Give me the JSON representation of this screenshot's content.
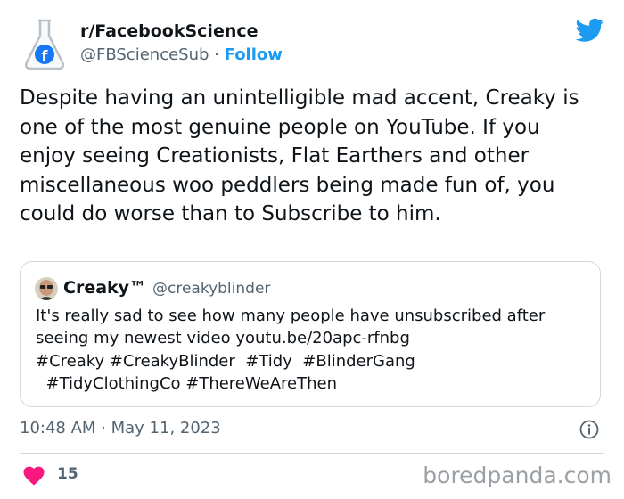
{
  "header": {
    "display_name": "r/FacebookScience",
    "handle": "@FBScienceSub",
    "separator": "·",
    "follow_label": "Follow"
  },
  "tweet": {
    "text": "Despite having an unintelligible mad accent, Creaky is one of the most genuine people on YouTube. If you enjoy seeing Creationists, Flat Earthers and other miscellaneous woo peddlers being made fun of, you could do worse than to Subscribe to him."
  },
  "quote": {
    "name": "Creaky™",
    "handle": "@creakyblinder",
    "text": "It's really sad to see how many people have unsubscribed after\nseeing my newest video youtu.be/20apc-rfnbg\n#Creaky #CreakyBlinder  #Tidy  #BlinderGang\n  #TidyClothingCo #ThereWeAreThen"
  },
  "footer": {
    "timestamp": "10:48 AM · May 11, 2023",
    "likes": "15",
    "watermark": "boredpanda.com"
  },
  "colors": {
    "accent": "#1d9bf0",
    "heart": "#f91880",
    "secondary_text": "#536471"
  },
  "icons": [
    "flask-facebook-avatar",
    "twitter-bird-icon",
    "info-icon",
    "heart-icon"
  ]
}
